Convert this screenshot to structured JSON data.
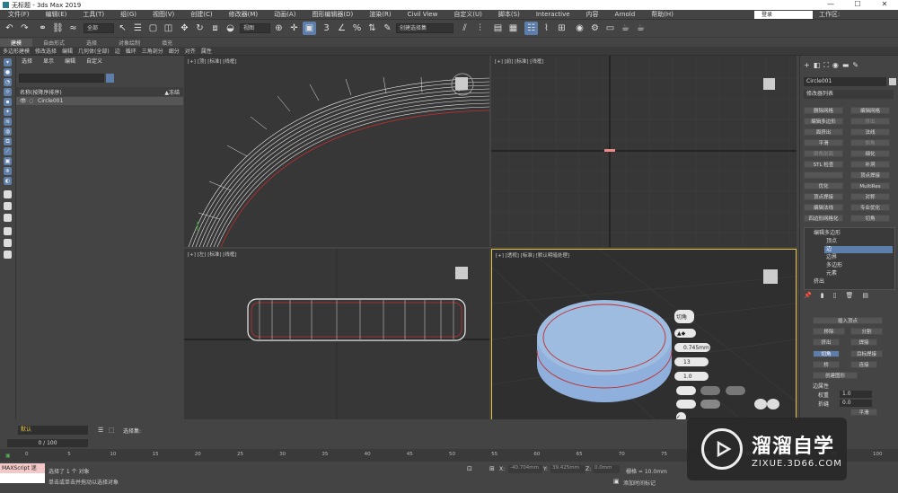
{
  "window": {
    "title": "无标题 - 3ds Max 2019",
    "min": "—",
    "max": "☐",
    "close": "✕"
  },
  "menu": [
    "文件(F)",
    "编辑(E)",
    "工具(T)",
    "组(G)",
    "视图(V)",
    "创建(C)",
    "修改器(M)",
    "动画(A)",
    "图形编辑器(D)",
    "渲染(R)",
    "Civil View",
    "自定义(U)",
    "脚本(S)",
    "Interactive",
    "内容",
    "Arnold",
    "帮助(H)"
  ],
  "login": "登录",
  "workspace": "工作区:",
  "toolbar": {
    "filter": "全部",
    "view": "视图",
    "selset": "创建选择集"
  },
  "ribbon_tabs": [
    "建模",
    "自由形式",
    "选择",
    "对象绘制",
    "填充"
  ],
  "ribbon_row2": [
    "多边形建模",
    "修改选择",
    "编辑",
    "几何体(全部)",
    "边",
    "循环",
    "三角剖分",
    "细分",
    "对齐",
    "属性"
  ],
  "scene_explorer": {
    "tabs": [
      "选择",
      "显示",
      "编辑",
      "自定义"
    ],
    "col_name": "名称(按降序排序)",
    "col_frozen": "▲冻结",
    "object": "Circle001"
  },
  "viewports": {
    "top": "[+] [顶] [标准] [线框]",
    "front": "[+] [前] [标准] [线框]",
    "left": "[+] [左] [标准] [线框]",
    "persp": "[+] [透视] [标准] [默认明暗处理]"
  },
  "chamfer_popup": {
    "title": "切角",
    "amount": "0.745mm",
    "segments": "13",
    "tension": "1.0"
  },
  "command_panel": {
    "object_name": "Circle001",
    "modifier_list": "修改器列表",
    "buttons": [
      [
        "删除网格",
        "编辑网格"
      ],
      [
        "编辑多边形",
        "挤出"
      ],
      [
        "面挤出",
        "法线"
      ],
      [
        "平滑",
        "倒角"
      ],
      [
        "倒角剖面",
        "细化"
      ],
      [
        "STL 检查",
        "补洞"
      ],
      [
        "",
        "顶点焊接"
      ],
      [
        "优化",
        "MultiRes"
      ],
      [
        "顶点焊接",
        "对称"
      ],
      [
        "编辑法线",
        "专业优化"
      ],
      [
        "四边形网格化",
        "切角"
      ]
    ],
    "stack": [
      "编辑多边形",
      "顶点",
      "边",
      "边界",
      "多边形",
      "元素",
      "挤出"
    ],
    "rollout": {
      "insert_vertex": "插入顶点",
      "remove": "移除",
      "split": "分割",
      "extrude": "挤出",
      "weld": "焊接",
      "chamfer": "切角",
      "target_weld": "目标焊接",
      "bridge": "桥",
      "connect": "连接",
      "create_shape": "创建图形",
      "edge_props": "边属性",
      "weight_label": "权重",
      "weight": "1.0",
      "crease_label": "折缝",
      "crease": "0.0",
      "smooth": "平滑"
    }
  },
  "bottom": {
    "layer": "默认",
    "selset": "选择集:",
    "frame": "0 / 100",
    "status1": "选择了 1 个 对象",
    "status2": "单击或单击并拖动以选择对象",
    "maxscript": "MAXScript 迷",
    "x": "-40.704mm",
    "y": "39.425mm",
    "z": "0.0mm",
    "grid": "栅格 = 10.0mm",
    "add_time": "添加时间标记",
    "ticks": [
      "0",
      "5",
      "10",
      "15",
      "20",
      "25",
      "30",
      "35",
      "40",
      "45",
      "50",
      "55",
      "60",
      "65",
      "70",
      "75",
      "80",
      "85",
      "90",
      "95",
      "100"
    ]
  },
  "watermark": {
    "title": "溜溜自学",
    "sub": "ZIXUE.3D66.COM"
  },
  "colors": {
    "accent": "#5d7eab",
    "ring_red": "#c03030",
    "disk": "#8fb0dc"
  }
}
